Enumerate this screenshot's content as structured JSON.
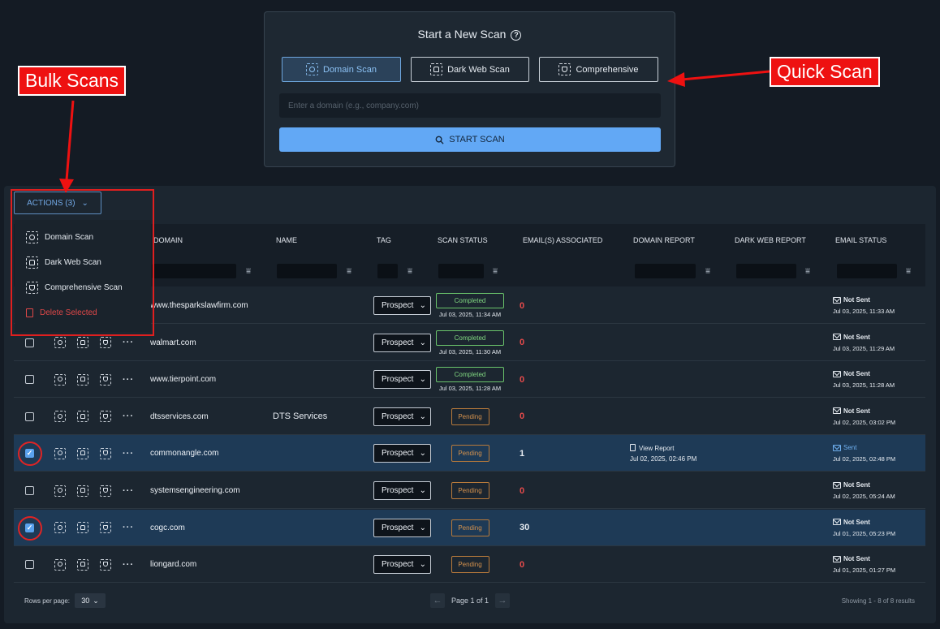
{
  "quick_scan": {
    "title": "Start a New Scan",
    "types": [
      {
        "label": "Domain Scan",
        "icon": "domain-scan-icon",
        "active": true
      },
      {
        "label": "Dark Web Scan",
        "icon": "dark-web-scan-icon",
        "active": false
      },
      {
        "label": "Comprehensive",
        "icon": "comprehensive-scan-icon",
        "active": false
      }
    ],
    "input_placeholder": "Enter a domain (e.g., company.com)",
    "start_label": "START SCAN"
  },
  "actions": {
    "label": "ACTIONS (3)",
    "menu": [
      {
        "label": "Domain Scan",
        "icon": "domain-scan-icon"
      },
      {
        "label": "Dark Web Scan",
        "icon": "dark-web-scan-icon"
      },
      {
        "label": "Comprehensive Scan",
        "icon": "comprehensive-scan-icon"
      },
      {
        "label": "Delete Selected",
        "icon": "trash-icon"
      }
    ]
  },
  "table": {
    "columns": [
      "DOMAIN",
      "NAME",
      "TAG",
      "SCAN STATUS",
      "EMAIL(S) ASSOCIATED",
      "DOMAIN REPORT",
      "DARK WEB REPORT",
      "EMAIL STATUS"
    ],
    "rows": [
      {
        "checked": false,
        "domain": "www.thesparkslawfirm.com",
        "name": "",
        "tag": "Prospect",
        "status": "Completed",
        "status_date": "Jul 03, 2025, 11:34 AM",
        "emails": "0",
        "domain_report": "",
        "domain_report_date": "",
        "email_status": "Not Sent",
        "email_date": "Jul 03, 2025, 11:33 AM"
      },
      {
        "checked": false,
        "domain": "walmart.com",
        "name": "",
        "tag": "Prospect",
        "status": "Completed",
        "status_date": "Jul 03, 2025, 11:30 AM",
        "emails": "0",
        "domain_report": "",
        "domain_report_date": "",
        "email_status": "Not Sent",
        "email_date": "Jul 03, 2025, 11:29 AM"
      },
      {
        "checked": false,
        "domain": "www.tierpoint.com",
        "name": "",
        "tag": "Prospect",
        "status": "Completed",
        "status_date": "Jul 03, 2025, 11:28 AM",
        "emails": "0",
        "domain_report": "",
        "domain_report_date": "",
        "email_status": "Not Sent",
        "email_date": "Jul 03, 2025, 11:28 AM"
      },
      {
        "checked": false,
        "domain": "dtsservices.com",
        "name": "DTS Services",
        "tag": "Prospect",
        "status": "Pending",
        "status_date": "",
        "emails": "0",
        "domain_report": "",
        "domain_report_date": "",
        "email_status": "Not Sent",
        "email_date": "Jul 02, 2025, 03:02 PM"
      },
      {
        "checked": true,
        "domain": "commonangle.com",
        "name": "",
        "tag": "Prospect",
        "status": "Pending",
        "status_date": "",
        "emails": "1",
        "domain_report": "View Report",
        "domain_report_date": "Jul 02, 2025, 02:46 PM",
        "email_status": "Sent",
        "email_date": "Jul 02, 2025, 02:48 PM"
      },
      {
        "checked": false,
        "domain": "systemsengineering.com",
        "name": "",
        "tag": "Prospect",
        "status": "Pending",
        "status_date": "",
        "emails": "0",
        "domain_report": "",
        "domain_report_date": "",
        "email_status": "Not Sent",
        "email_date": "Jul 02, 2025, 05:24 AM"
      },
      {
        "checked": true,
        "domain": "cogc.com",
        "name": "",
        "tag": "Prospect",
        "status": "Pending",
        "status_date": "",
        "emails": "30",
        "domain_report": "",
        "domain_report_date": "",
        "email_status": "Not Sent",
        "email_date": "Jul 01, 2025, 05:23 PM"
      },
      {
        "checked": false,
        "domain": "liongard.com",
        "name": "",
        "tag": "Prospect",
        "status": "Pending",
        "status_date": "",
        "emails": "0",
        "domain_report": "",
        "domain_report_date": "",
        "email_status": "Not Sent",
        "email_date": "Jul 01, 2025, 01:27 PM"
      }
    ]
  },
  "footer": {
    "rows_per_page_label": "Rows per page:",
    "rows_per_page": "30",
    "page_label": "Page 1 of 1",
    "showing": "Showing 1 - 8 of 8 results"
  },
  "callouts": {
    "bulk": "Bulk Scans",
    "quick": "Quick Scan"
  },
  "colors": {
    "accent": "#62a8f5",
    "annotation": "#ee1111",
    "completed": "#80d780",
    "pending": "#d5924d",
    "zero_emails": "#e84b4b"
  }
}
